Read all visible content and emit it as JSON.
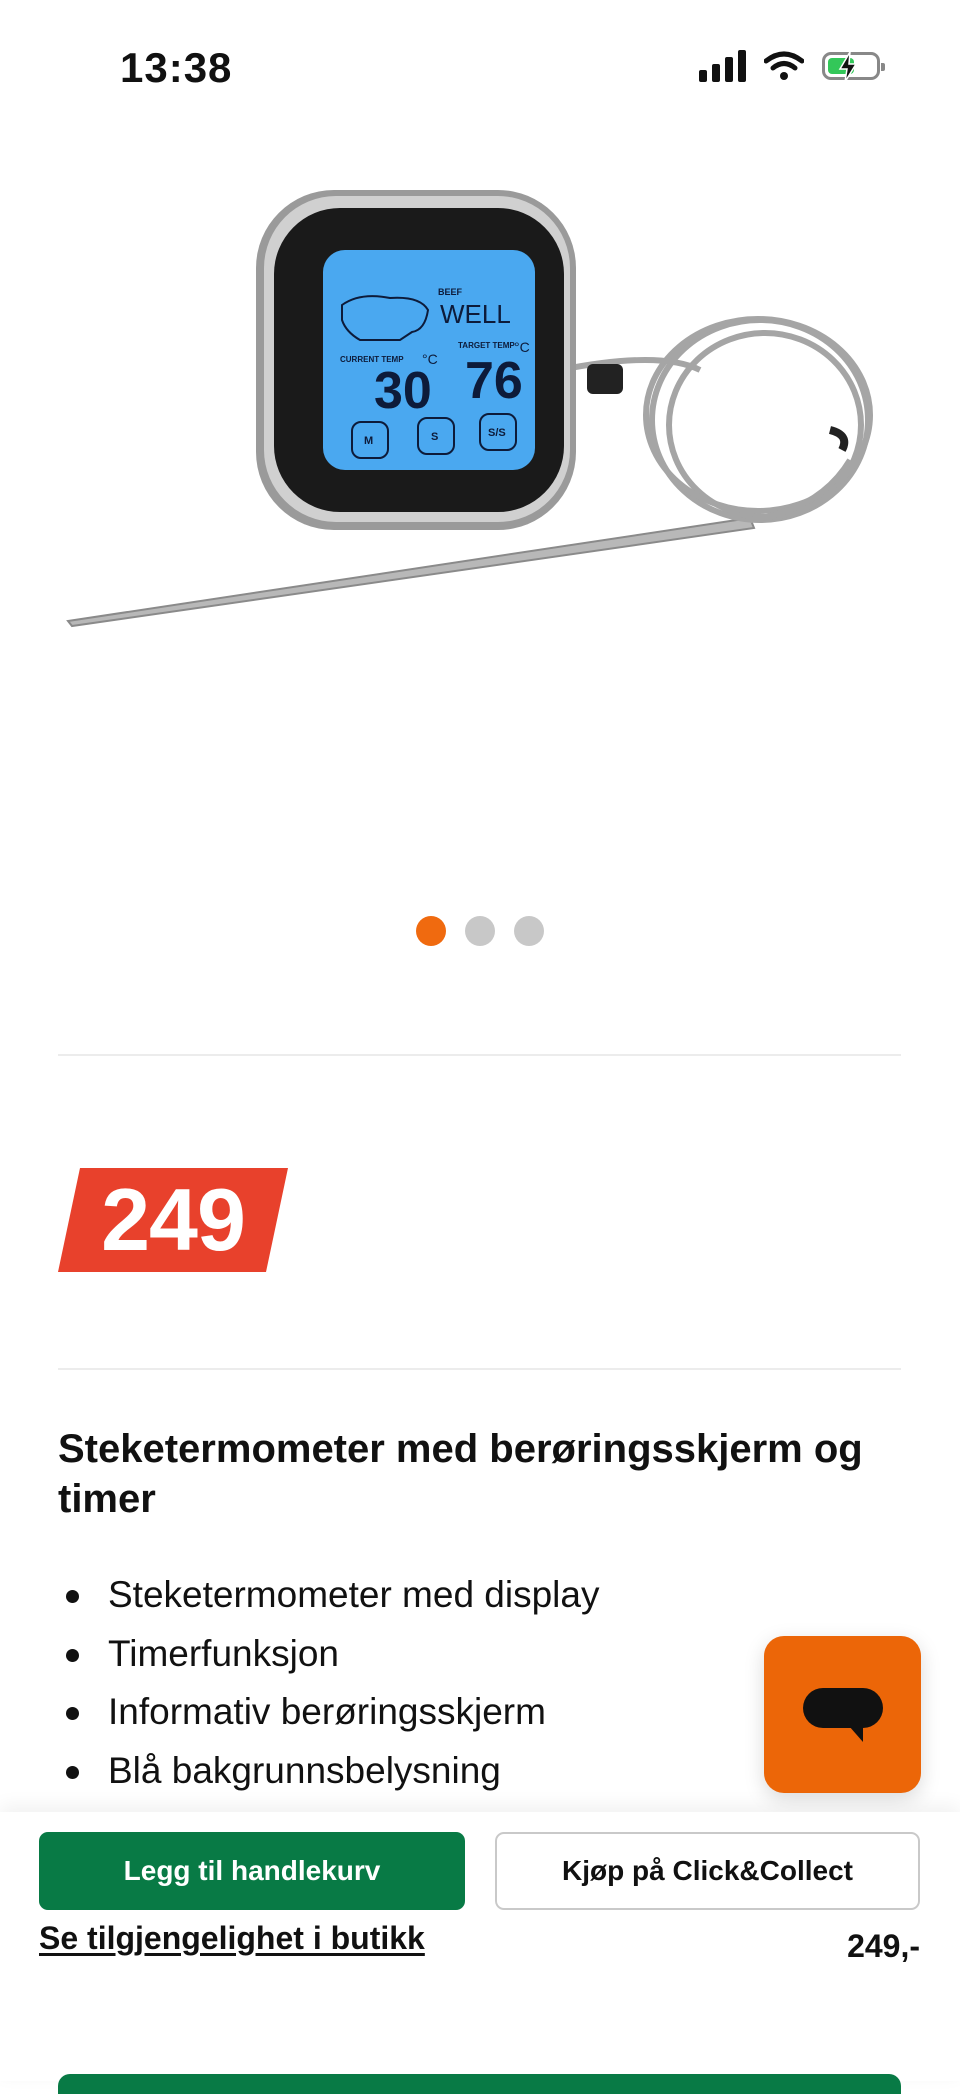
{
  "status_bar": {
    "time": "13:38"
  },
  "gallery": {
    "image_alt": "Steketermometer",
    "dots": 3,
    "active_dot": 0
  },
  "product": {
    "price": "249",
    "title": "Steketermometer med berøringsskjerm og timer",
    "features": [
      "Steketermometer med display",
      "Timerfunksjon",
      "Informativ berøringsskjerm",
      "Blå bakgrunnsbelysning"
    ]
  },
  "device_display": {
    "label_beef": "BEEF",
    "label_doneness": "WELL",
    "label_current": "CURRENT TEMP",
    "label_target": "TARGET TEMP",
    "current_temp": "30",
    "target_temp": "76",
    "unit": "°C",
    "btn_m": "M",
    "btn_s": "S",
    "btn_ss": "S/S"
  },
  "bottom_bar": {
    "add_to_cart": "Legg til handlekurv",
    "click_collect": "Kjøp på Click&Collect",
    "availability": "Se tilgjengelighet i butikk",
    "price": "249,-"
  },
  "colors": {
    "accent_orange": "#ec6608",
    "price_red": "#e8412c",
    "button_green": "#087a45",
    "display_blue": "#4aa8f0"
  }
}
